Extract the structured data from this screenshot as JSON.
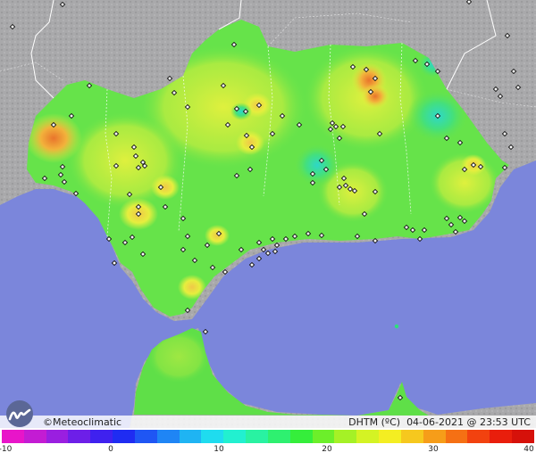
{
  "map": {
    "colors": {
      "sea": "#7b86db",
      "foreign_land": "#a9a9ab",
      "land_base": "#66e34a",
      "warm_yellow": "#dff03e",
      "hot_orange": "#f2b23b",
      "hot_red": "#ea8a2f",
      "cool_cyan": "#3ee08c",
      "border": "#ffffff",
      "station": "#111111"
    }
  },
  "footer": {
    "brand": "©Meteoclimatic",
    "logo_icon": "meteoclimatic-logo",
    "variable": "DHTM (ºC)",
    "timestamp": "04-06-2021 @ 23:53 UTC"
  },
  "scale": {
    "ticks": [
      "-10",
      "0",
      "10",
      "20",
      "30",
      "40"
    ],
    "colors": [
      "#e815c9",
      "#c31cd3",
      "#9a1fe0",
      "#6d1fe8",
      "#3f21ef",
      "#1f2cf2",
      "#1f56f4",
      "#1f85f5",
      "#1fb4f3",
      "#1fdcef",
      "#22f0d0",
      "#29f2a2",
      "#2ef070",
      "#35ee3b",
      "#6cef2a",
      "#a5f126",
      "#d4f324",
      "#f4ee22",
      "#f6c81e",
      "#f69d19",
      "#f57014",
      "#f2420f",
      "#e91e0c",
      "#d6110a"
    ]
  }
}
